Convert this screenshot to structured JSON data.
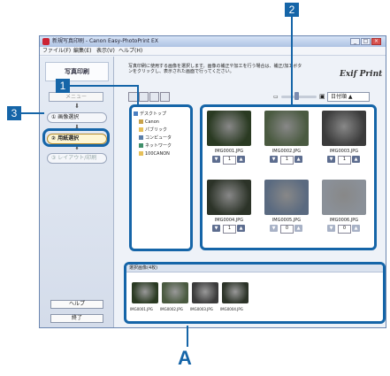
{
  "window": {
    "title": "新規写真印刷 - Canon Easy-PhotoPrint EX",
    "controls": [
      "minimize",
      "maximize",
      "close"
    ]
  },
  "menubar": [
    "ファイル(F)",
    "編集(E)",
    "表示(V)",
    "ヘルプ(H)"
  ],
  "left_panel": {
    "title": "写真印刷",
    "menu_button": "メニュー",
    "steps": [
      {
        "label": "① 画像選択"
      },
      {
        "label": "② 用紙選択"
      },
      {
        "label": "③ レイアウト/印刷"
      }
    ],
    "help_button": "ヘルプ",
    "exit_button": "終了"
  },
  "main": {
    "instruction": "写真印刷に使用する画像を選択します。画像の補正や加工を行う場合は、補正/加工ボタンをクリックし、表示された画面で行ってください。",
    "logo": "Exif Print",
    "sort_select": "日付順 ▲"
  },
  "tree": [
    {
      "label": "デスクトップ"
    },
    {
      "label": "Canon"
    },
    {
      "label": "パブリック"
    },
    {
      "label": "コンピュータ"
    },
    {
      "label": "ネットワーク"
    },
    {
      "label": "100CANON"
    }
  ],
  "thumbnails": [
    {
      "name": "IMG0001.JPG",
      "count": "1",
      "color": "#2a3a22"
    },
    {
      "name": "IMG0002.JPG",
      "count": "1",
      "color": "#4a5a40"
    },
    {
      "name": "IMG0003.JPG",
      "count": "1",
      "color": "#3b3b3b"
    },
    {
      "name": "IMG0004.JPG",
      "count": "1",
      "color": "#2c3328"
    },
    {
      "name": "IMG0005.JPG",
      "count": "0",
      "color": "#5a6a80"
    },
    {
      "name": "IMG0006.JPG",
      "count": "0",
      "color": "#8a9098"
    }
  ],
  "strip": {
    "header": "選択画像(4枚)",
    "items": [
      {
        "name": "IMG0001.JPG",
        "color": "#2a3a22"
      },
      {
        "name": "IMG0002.JPG",
        "color": "#4a5a40"
      },
      {
        "name": "IMG0003.JPG",
        "color": "#3b3b3b"
      },
      {
        "name": "IMG0004.JPG",
        "color": "#2c3328"
      }
    ]
  },
  "callouts": {
    "c1": "1",
    "c2": "2",
    "c3": "3",
    "A": "A"
  },
  "accent_color": "#1565a8"
}
